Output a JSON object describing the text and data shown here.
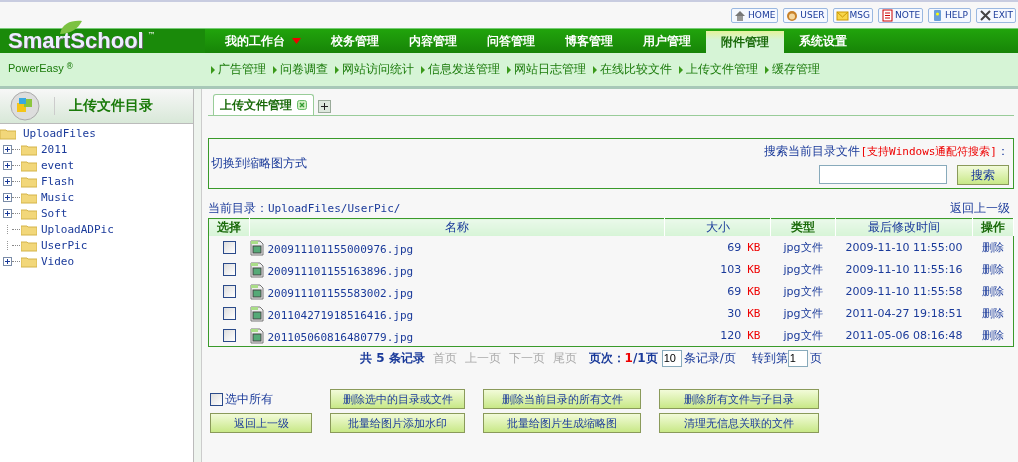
{
  "top_links": [
    {
      "label": "HOME",
      "kind": "home"
    },
    {
      "label": "USER",
      "kind": "user"
    },
    {
      "label": "MSG",
      "kind": "msg"
    },
    {
      "label": "NOTE",
      "kind": "note"
    },
    {
      "label": "HELP",
      "kind": "help"
    },
    {
      "label": "EXIT",
      "kind": "exit"
    }
  ],
  "logo": {
    "name": "SmartSchool",
    "tm": "™",
    "sub": "PowerEasy",
    "reg": "®"
  },
  "main_nav": [
    {
      "label": "我的工作台",
      "dropdown": true,
      "selected": false
    },
    {
      "label": "校务管理",
      "dropdown": false,
      "selected": false
    },
    {
      "label": "内容管理",
      "dropdown": false,
      "selected": false
    },
    {
      "label": "问答管理",
      "dropdown": false,
      "selected": false
    },
    {
      "label": "博客管理",
      "dropdown": false,
      "selected": false
    },
    {
      "label": "用户管理",
      "dropdown": false,
      "selected": false
    },
    {
      "label": "附件管理",
      "dropdown": false,
      "selected": true
    },
    {
      "label": "系统设置",
      "dropdown": false,
      "selected": false
    }
  ],
  "sub_nav": [
    "广告管理",
    "问卷调查",
    "网站访问统计",
    "信息发送管理",
    "网站日志管理",
    "在线比较文件",
    "上传文件管理",
    "缓存管理"
  ],
  "sidebar": {
    "title": "上传文件目录",
    "tree": {
      "label": "UploadFiles",
      "children": [
        {
          "label": "2011",
          "expandable": true
        },
        {
          "label": "event",
          "expandable": true
        },
        {
          "label": "Flash",
          "expandable": true
        },
        {
          "label": "Music",
          "expandable": true
        },
        {
          "label": "Soft",
          "expandable": true
        },
        {
          "label": "UploadADPic",
          "expandable": false
        },
        {
          "label": "UserPic",
          "expandable": false
        },
        {
          "label": "Video",
          "expandable": true
        }
      ]
    }
  },
  "tabs": [
    {
      "label": "上传文件管理",
      "selected": true
    }
  ],
  "switch_link": "切换到缩略图方式",
  "search": {
    "label": "搜索当前目录文件",
    "hint": "[支持Windows通配符搜索]",
    "colon": "：",
    "button": "搜索"
  },
  "current_dir": {
    "label": "当前目录：",
    "path": "UploadFiles/UserPic/",
    "back": "返回上一级"
  },
  "table": {
    "columns": [
      "选择",
      "名称",
      "大小",
      "类型",
      "最后修改时间",
      "操作"
    ],
    "rows": [
      {
        "checked": false,
        "name": "200911101155000976.jpg",
        "size": "69",
        "unit": "KB",
        "type": "jpg文件",
        "modified": "2009-11-10 11:55:00",
        "action": "删除"
      },
      {
        "checked": false,
        "name": "200911101155163896.jpg",
        "size": "103",
        "unit": "KB",
        "type": "jpg文件",
        "modified": "2009-11-10 11:55:16",
        "action": "删除"
      },
      {
        "checked": false,
        "name": "200911101155583002.jpg",
        "size": "69",
        "unit": "KB",
        "type": "jpg文件",
        "modified": "2009-11-10 11:55:58",
        "action": "删除"
      },
      {
        "checked": false,
        "name": "201104271918516416.jpg",
        "size": "30",
        "unit": "KB",
        "type": "jpg文件",
        "modified": "2011-04-27 19:18:51",
        "action": "删除"
      },
      {
        "checked": false,
        "name": "201105060816480779.jpg",
        "size": "120",
        "unit": "KB",
        "type": "jpg文件",
        "modified": "2011-05-06 08:16:48",
        "action": "删除"
      }
    ]
  },
  "pager": {
    "total_prefix": "共",
    "total": "5",
    "total_suffix": "条记录",
    "links": [
      {
        "label": "首页",
        "disabled": true
      },
      {
        "label": "上一页",
        "disabled": true
      },
      {
        "label": "下一页",
        "disabled": true
      },
      {
        "label": "尾页",
        "disabled": true
      }
    ],
    "page_label": "页次：",
    "page": "1",
    "page_of": "/1页",
    "per_page": "10",
    "per_page_label": "条记录/页",
    "goto_label": "转到第",
    "goto": "1",
    "goto_suffix": "页"
  },
  "select_all": {
    "label": "选中所有",
    "checked": false
  },
  "actions": [
    "删除选中的目录或文件",
    "删除当前目录的所有文件",
    "删除所有文件与子目录",
    "返回上一级",
    "批量给图片添加水印",
    "批量给图片生成缩略图",
    "清理无信息关联的文件"
  ]
}
